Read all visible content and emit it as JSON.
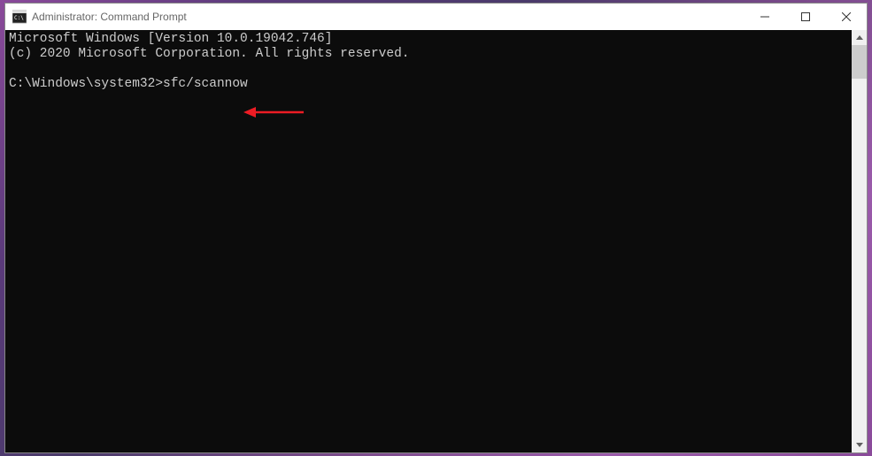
{
  "window": {
    "title": "Administrator: Command Prompt"
  },
  "terminal": {
    "line1": "Microsoft Windows [Version 10.0.19042.746]",
    "line2": "(c) 2020 Microsoft Corporation. All rights reserved.",
    "blank": "",
    "prompt": "C:\\Windows\\system32>",
    "command": "sfc/scannow"
  },
  "annotation": {
    "color": "#ed1c24"
  }
}
